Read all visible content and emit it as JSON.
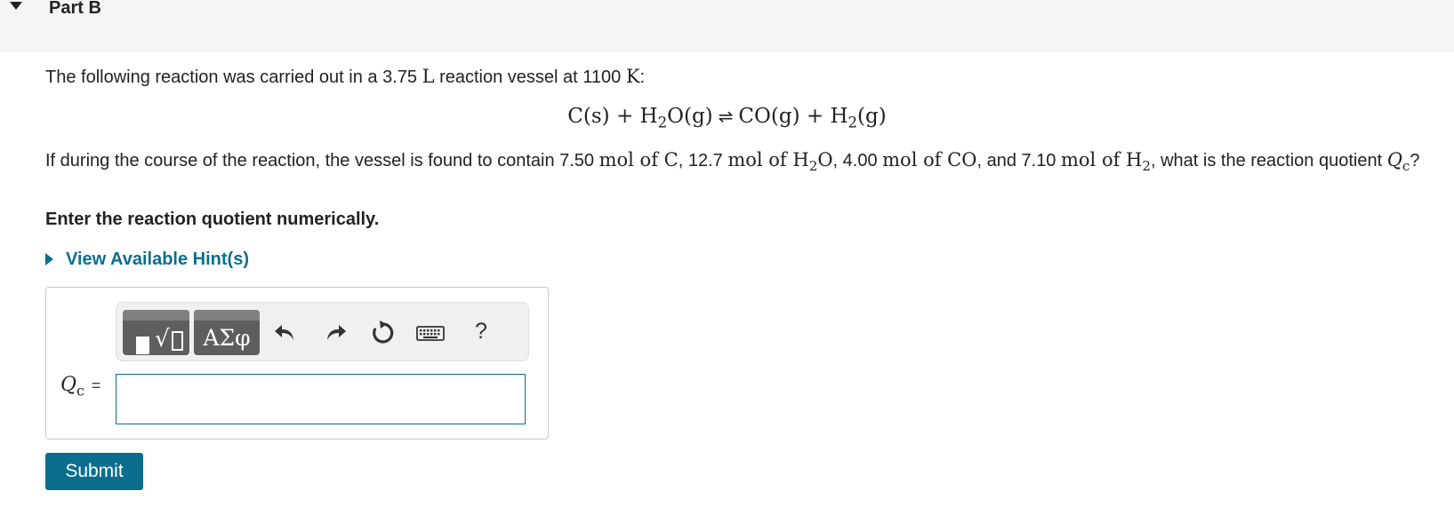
{
  "part": {
    "title": "Part B"
  },
  "problem": {
    "p1_before": "The following reaction was carried out in a 3.75 ",
    "p1_unit_volume": "L",
    "p1_middle": " reaction vessel at 1100 ",
    "p1_unit_temp": "K",
    "p1_after": ":",
    "equation": {
      "left": "C(s) + H",
      "left_sub": "2",
      "left_rest": "O(g)",
      "arrow": "⇌",
      "right": "CO(g) + H",
      "right_sub": "2",
      "right_rest": "(g)"
    },
    "p2": {
      "t1": "If during the course of the reaction, the vessel is found to contain 7.50 ",
      "m1": "mol of C",
      "t2": ", 12.7 ",
      "m2": "mol of H",
      "m2_sub": "2",
      "m2_rest": "O",
      "t3": ", 4.00 ",
      "m3": "mol of CO",
      "t4": ", and 7.10 ",
      "m4": "mol of H",
      "m4_sub": "2",
      "t5": ", what is the reaction quotient",
      "q": "Q",
      "q_sub": "c",
      "t6": "?"
    },
    "instruction": "Enter the reaction quotient numerically."
  },
  "hint": {
    "label": "View Available Hint(s)"
  },
  "answer": {
    "label_var": "Q",
    "label_sub": "c",
    "equals": "=",
    "input_value": "",
    "toolbar": {
      "templates_icon": "templates-radical-icon",
      "symbols_label": "ΑΣφ",
      "undo_icon": "undo-icon",
      "redo_icon": "redo-icon",
      "reset_icon": "reset-icon",
      "keyboard_icon": "keyboard-icon",
      "help_label": "?"
    }
  },
  "submit": {
    "label": "Submit"
  },
  "colors": {
    "accent": "#0b6e8e",
    "header_bg": "#f4f4f4",
    "toolbar_button": "#5e5e5e"
  }
}
